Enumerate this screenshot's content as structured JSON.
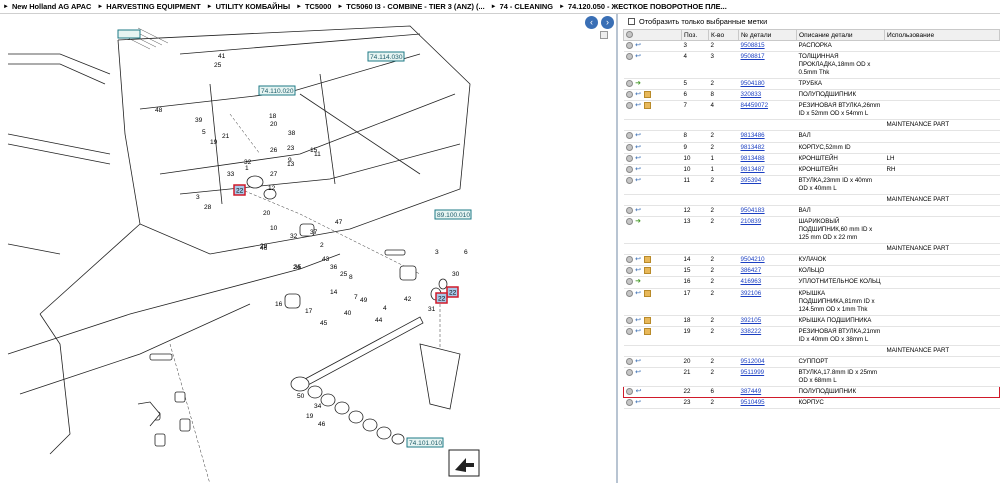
{
  "breadcrumb": [
    "New Holland AG APAC",
    "HARVESTING EQUIPMENT",
    "UTILITY КОМБАЙНЫ",
    "TC5000",
    "TC5060 I3 - COMBINE - TIER 3 (ANZ) (...",
    "74 - CLEANING",
    "74.120.050 - ЖЕСТКОЕ ПОВОРОТНОЕ ПЛЕ..."
  ],
  "filter": {
    "label": "Отобразить только выбранные метки"
  },
  "table": {
    "headers": [
      "",
      "Поз.",
      "К-во",
      "№ детали",
      "Описание детали",
      "Использование"
    ],
    "rows": [
      {
        "type": "part",
        "icon2": "arrow",
        "pos": "3",
        "qty": "2",
        "part": "9508815",
        "desc": "РАСПОРКА",
        "use": ""
      },
      {
        "type": "part",
        "icon2": "arrow",
        "pos": "4",
        "qty": "3",
        "part": "9508817",
        "desc": "ТОЛЩИННАЯ ПРОКЛАДКА,18mm OD x 0.5mm Thk",
        "use": ""
      },
      {
        "type": "part",
        "icon2": "green",
        "pos": "5",
        "qty": "2",
        "part": "9504180",
        "desc": "ТРУБКА",
        "use": ""
      },
      {
        "type": "part",
        "icon2": "arrow",
        "box": true,
        "pos": "6",
        "qty": "8",
        "part": "320833",
        "desc": "ПОЛУПОДШИПНИК",
        "use": ""
      },
      {
        "type": "part",
        "icon2": "arrow",
        "box": true,
        "pos": "7",
        "qty": "4",
        "part": "84459072",
        "desc": "РЕЗИНОВАЯ ВТУЛКА,26mm ID x 52mm OD x 54mm L",
        "use": ""
      },
      {
        "type": "note",
        "text": "MAINTENANCE PART"
      },
      {
        "type": "part",
        "icon2": "arrow",
        "pos": "8",
        "qty": "2",
        "part": "9813486",
        "desc": "ВАЛ",
        "use": ""
      },
      {
        "type": "part",
        "icon2": "arrow",
        "pos": "9",
        "qty": "2",
        "part": "9813482",
        "desc": "КОРПУС,52mm ID",
        "use": ""
      },
      {
        "type": "part",
        "icon2": "arrow",
        "pos": "10",
        "qty": "1",
        "part": "9813488",
        "desc": "КРОНШТЕЙН",
        "use": "LH"
      },
      {
        "type": "part",
        "icon2": "arrow",
        "pos": "10",
        "qty": "1",
        "part": "9813487",
        "desc": "КРОНШТЕЙН",
        "use": "RH"
      },
      {
        "type": "part",
        "icon2": "arrow",
        "pos": "11",
        "qty": "2",
        "part": "395394",
        "desc": "ВТУЛКА,23mm ID x 40mm OD x 40mm L",
        "use": ""
      },
      {
        "type": "note",
        "text": "MAINTENANCE PART"
      },
      {
        "type": "part",
        "icon2": "arrow",
        "pos": "12",
        "qty": "2",
        "part": "9504183",
        "desc": "ВАЛ",
        "use": ""
      },
      {
        "type": "part",
        "icon2": "green",
        "pos": "13",
        "qty": "2",
        "part": "210839",
        "desc": "ШАРИКОВЫЙ ПОДШИПНИК,60 mm ID x 125 mm OD x 22 mm",
        "use": ""
      },
      {
        "type": "note",
        "text": "MAINTENANCE PART"
      },
      {
        "type": "part",
        "icon2": "arrow",
        "box": true,
        "pos": "14",
        "qty": "2",
        "part": "9504210",
        "desc": "КУЛАЧОК",
        "use": ""
      },
      {
        "type": "part",
        "icon2": "arrow",
        "box": true,
        "pos": "15",
        "qty": "2",
        "part": "386427",
        "desc": "КОЛЬЦО",
        "use": ""
      },
      {
        "type": "part",
        "icon2": "green",
        "pos": "16",
        "qty": "2",
        "part": "416963",
        "desc": "УПЛОТНИТЕЛЬНОЕ КОЛЬЦ",
        "use": ""
      },
      {
        "type": "part",
        "icon2": "arrow",
        "box": true,
        "pos": "17",
        "qty": "2",
        "part": "392106",
        "desc": "КРЫШКА ПОДШИПНИКА,81mm ID x 124.5mm OD x 1mm Thk",
        "use": ""
      },
      {
        "type": "part",
        "icon2": "arrow",
        "box": true,
        "pos": "18",
        "qty": "2",
        "part": "392105",
        "desc": "КРЫШКА ПОДШИПНИКА",
        "use": ""
      },
      {
        "type": "part",
        "icon2": "arrow",
        "box": true,
        "pos": "19",
        "qty": "2",
        "part": "338222",
        "desc": "РЕЗИНОВАЯ ВТУЛКА,21mm ID x 40mm OD x 38mm L",
        "use": ""
      },
      {
        "type": "note",
        "text": "MAINTENANCE PART"
      },
      {
        "type": "part",
        "icon2": "arrow",
        "pos": "20",
        "qty": "2",
        "part": "9512004",
        "desc": "СУППОРТ",
        "use": ""
      },
      {
        "type": "part",
        "icon2": "arrow",
        "pos": "21",
        "qty": "2",
        "part": "9511999",
        "desc": "ВТУЛКА,17.8mm ID x 25mm OD x 68mm L",
        "use": ""
      },
      {
        "type": "part",
        "icon2": "arrow",
        "pos": "22",
        "qty": "6",
        "part": "387449",
        "desc": "ПОЛУПОДШИПНИК",
        "use": "",
        "selected": true
      },
      {
        "type": "part",
        "icon2": "arrow",
        "pos": "23",
        "qty": "2",
        "part": "9510495",
        "desc": "КОРПУС",
        "use": ""
      }
    ]
  },
  "diagram": {
    "refs": [
      "74.114.030",
      "74.110.020",
      "89.100.010",
      "74.101.010"
    ],
    "selected_callouts": [
      "22",
      "22",
      "22"
    ],
    "callouts": [
      "41",
      "25",
      "48",
      "39",
      "5",
      "19",
      "21",
      "20",
      "18",
      "38",
      "23",
      "33",
      "32",
      "1",
      "9",
      "15",
      "26",
      "13",
      "3",
      "28",
      "12",
      "11",
      "27",
      "20",
      "10",
      "47",
      "46",
      "37",
      "32",
      "2",
      "29",
      "6",
      "30",
      "24",
      "31",
      "3",
      "43",
      "36",
      "25",
      "8",
      "35",
      "14",
      "16",
      "17",
      "45",
      "7",
      "4",
      "40",
      "42",
      "44",
      "49",
      "50",
      "34",
      "19",
      "46"
    ]
  },
  "colors": {
    "selected": "#d01a2a",
    "ref_box": "#1e7a86",
    "link": "#1b3fc2",
    "nav": "#3a6fb5"
  }
}
